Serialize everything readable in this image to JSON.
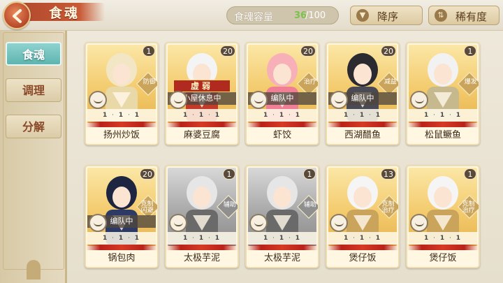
{
  "header": {
    "title": "食魂",
    "capacity_label": "食魂容量",
    "capacity_current": "36",
    "capacity_max": "/100"
  },
  "sort": {
    "order_label": "降序",
    "rarity_label": "稀有度"
  },
  "sidebar": {
    "items": [
      {
        "label": "食魂",
        "active": true
      },
      {
        "label": "调理",
        "active": false
      },
      {
        "label": "分解",
        "active": false
      }
    ]
  },
  "cards": [
    {
      "name": "扬州炒饭",
      "level": "1",
      "role": "防御",
      "status": "",
      "stamp": "",
      "stats": [
        "1",
        "1",
        "1"
      ],
      "tone": "gold"
    },
    {
      "name": "麻婆豆腐",
      "level": "20",
      "role": "",
      "status": "小屋休息中",
      "stamp": "虚弱",
      "stats": [
        "1",
        "1",
        "1"
      ],
      "tone": "gold"
    },
    {
      "name": "虾饺",
      "level": "20",
      "role": "治疗",
      "status": "编队中",
      "stamp": "",
      "stats": [
        "1",
        "1",
        "1"
      ],
      "tone": "gold"
    },
    {
      "name": "西湖醋鱼",
      "level": "20",
      "role": "减益",
      "status": "编队中",
      "stamp": "",
      "stats": [
        "1",
        "1",
        "1"
      ],
      "tone": "gold"
    },
    {
      "name": "松鼠鳜鱼",
      "level": "1",
      "role": "爆发",
      "status": "",
      "stamp": "",
      "stats": [
        "1",
        "1",
        "1"
      ],
      "tone": "gold"
    },
    {
      "name": "锅包肉",
      "level": "20",
      "role": "克制 闪避",
      "status": "编队中",
      "stamp": "",
      "stats": [
        "1",
        "1",
        "1"
      ],
      "tone": "gold"
    },
    {
      "name": "太极芋泥",
      "level": "1",
      "role": "辅助",
      "status": "",
      "stamp": "",
      "stats": [
        "1",
        "1",
        "1"
      ],
      "tone": "gray"
    },
    {
      "name": "太极芋泥",
      "level": "1",
      "role": "辅助",
      "status": "",
      "stamp": "",
      "stats": [
        "1",
        "1",
        "1"
      ],
      "tone": "gray"
    },
    {
      "name": "煲仔饭",
      "level": "13",
      "role": "克制 治疗",
      "status": "",
      "stamp": "",
      "stats": [
        "1",
        "1",
        "1"
      ],
      "tone": "gold"
    },
    {
      "name": "煲仔饭",
      "level": "1",
      "role": "克制 治疗",
      "status": "",
      "stamp": "",
      "stats": [
        "1",
        "1",
        "1"
      ],
      "tone": "gold"
    }
  ]
}
